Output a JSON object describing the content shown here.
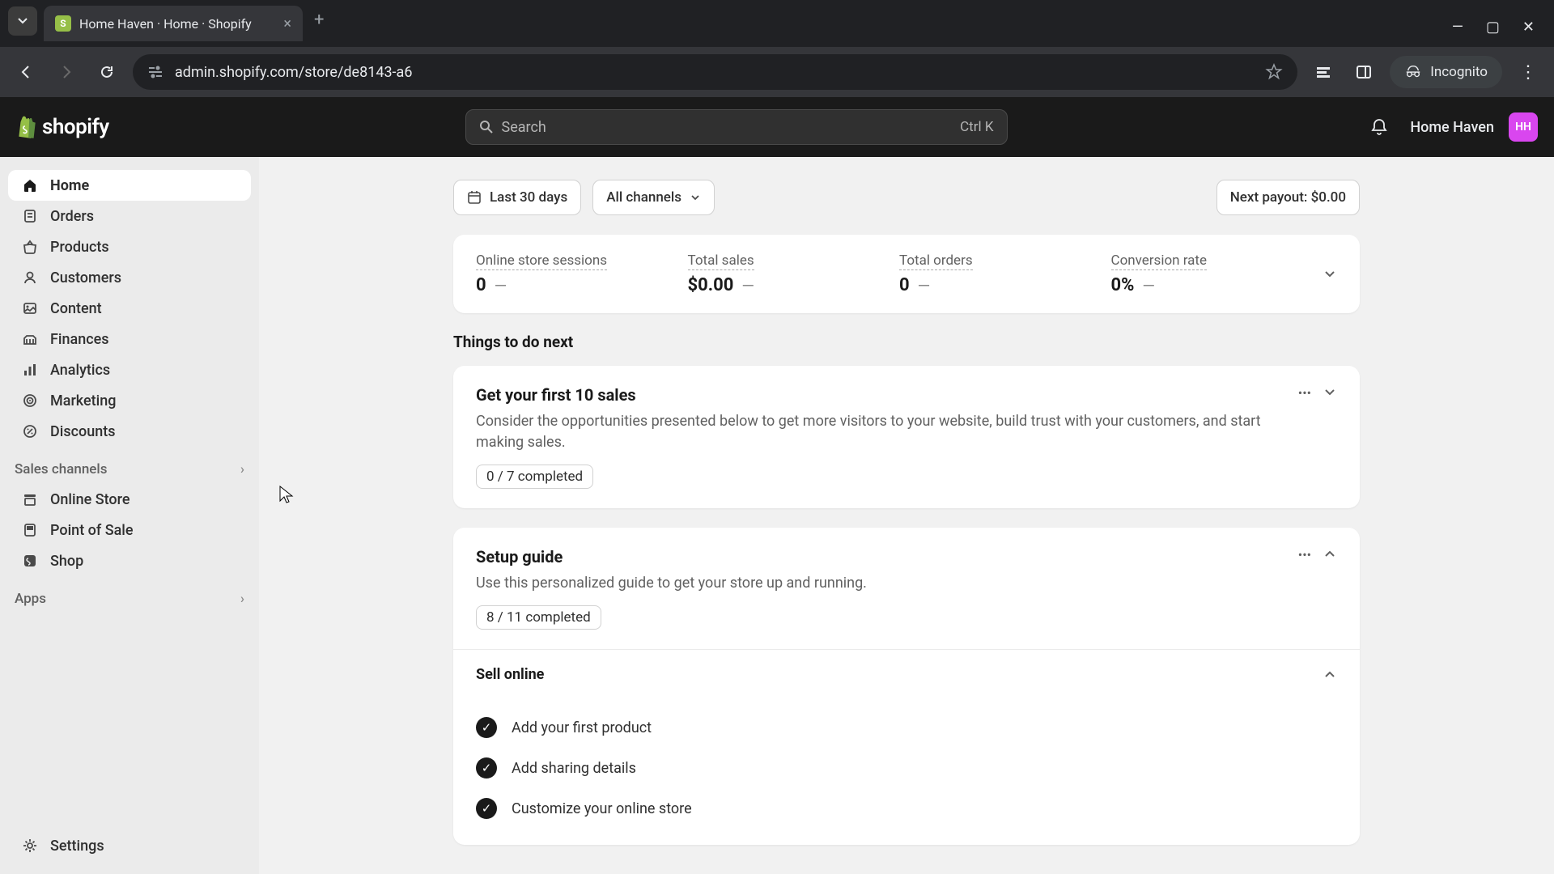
{
  "browser": {
    "tab_title": "Home Haven · Home · Shopify",
    "url": "admin.shopify.com/store/de8143-a6",
    "incognito_label": "Incognito"
  },
  "header": {
    "logo_text": "shopify",
    "search_placeholder": "Search",
    "search_shortcut": "Ctrl K",
    "store_name": "Home Haven",
    "store_initials": "HH"
  },
  "sidebar": {
    "items": [
      {
        "label": "Home",
        "icon": "home"
      },
      {
        "label": "Orders",
        "icon": "orders"
      },
      {
        "label": "Products",
        "icon": "products"
      },
      {
        "label": "Customers",
        "icon": "customers"
      },
      {
        "label": "Content",
        "icon": "content"
      },
      {
        "label": "Finances",
        "icon": "finances"
      },
      {
        "label": "Analytics",
        "icon": "analytics"
      },
      {
        "label": "Marketing",
        "icon": "marketing"
      },
      {
        "label": "Discounts",
        "icon": "discounts"
      }
    ],
    "sales_channels_label": "Sales channels",
    "channels": [
      {
        "label": "Online Store"
      },
      {
        "label": "Point of Sale"
      },
      {
        "label": "Shop"
      }
    ],
    "apps_label": "Apps",
    "settings_label": "Settings"
  },
  "filters": {
    "date_range": "Last 30 days",
    "channel": "All channels",
    "payout": "Next payout: $0.00"
  },
  "stats": [
    {
      "label": "Online store sessions",
      "value": "0"
    },
    {
      "label": "Total sales",
      "value": "$0.00"
    },
    {
      "label": "Total orders",
      "value": "0"
    },
    {
      "label": "Conversion rate",
      "value": "0%"
    }
  ],
  "section_title": "Things to do next",
  "guides": [
    {
      "title": "Get your first 10 sales",
      "description": "Consider the opportunities presented below to get more visitors to your website, build trust with your customers, and start making sales.",
      "progress": "0 / 7 completed"
    },
    {
      "title": "Setup guide",
      "description": "Use this personalized guide to get your store up and running.",
      "progress": "8 / 11 completed"
    }
  ],
  "setup": {
    "section": "Sell online",
    "tasks": [
      {
        "label": "Add your first product",
        "done": true
      },
      {
        "label": "Add sharing details",
        "done": true
      },
      {
        "label": "Customize your online store",
        "done": true
      }
    ]
  }
}
